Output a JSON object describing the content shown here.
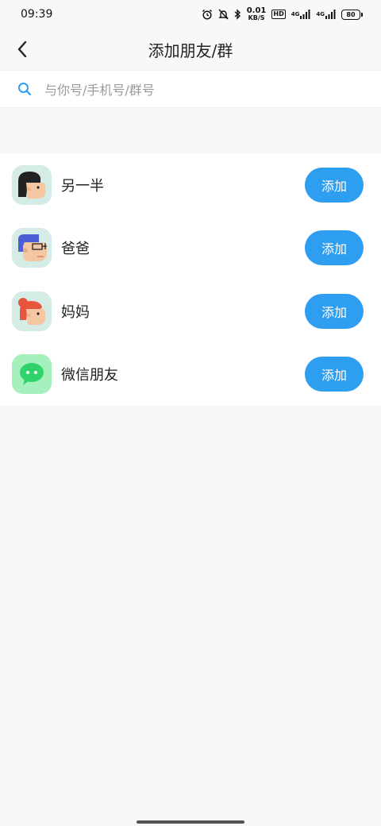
{
  "status_bar": {
    "time": "09:39",
    "net_speed_value": "0.01",
    "net_speed_unit": "KB/S",
    "hd_label": "HD",
    "sim1_label": "4G",
    "sim2_label": "4G",
    "battery_level": "80"
  },
  "nav": {
    "title": "添加朋友/群"
  },
  "search": {
    "placeholder": "与你号/手机号/群号",
    "accent_color": "#2d9ef0"
  },
  "contacts": [
    {
      "label": "另一半",
      "button": "添加",
      "icon": "woman-face-icon"
    },
    {
      "label": "爸爸",
      "button": "添加",
      "icon": "dad-face-icon"
    },
    {
      "label": "妈妈",
      "button": "添加",
      "icon": "mom-face-icon"
    },
    {
      "label": "微信朋友",
      "button": "添加",
      "icon": "wechat-icon"
    }
  ],
  "colors": {
    "button_blue": "#2d9ef0",
    "avatar_bg": "#d5ece6",
    "wechat_bg": "#a6f0bd",
    "wechat_green": "#2fd26b"
  }
}
